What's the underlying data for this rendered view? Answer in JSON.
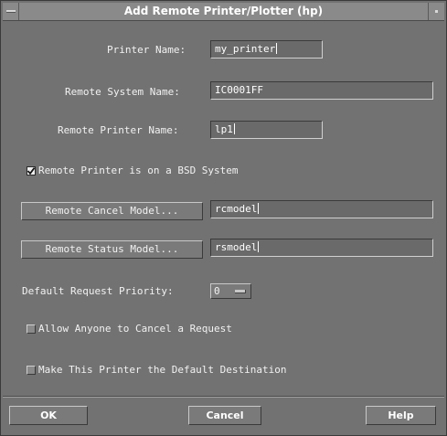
{
  "window": {
    "title": "Add Remote Printer/Plotter (hp)"
  },
  "form": {
    "printer_name_label": "Printer Name:",
    "printer_name_value": "my_printer",
    "remote_system_label": "Remote System Name:",
    "remote_system_value": "IC0001FF",
    "remote_printer_label": "Remote Printer Name:",
    "remote_printer_value": "lp1",
    "bsd_checkbox_label": "Remote Printer is on a BSD System",
    "bsd_checked": true,
    "cancel_model_button": "Remote Cancel Model...",
    "cancel_model_value": "rcmodel",
    "status_model_button": "Remote Status Model...",
    "status_model_value": "rsmodel",
    "priority_label": "Default Request Priority:",
    "priority_value": "0",
    "allow_cancel_label": "Allow Anyone to Cancel a Request",
    "allow_cancel_checked": false,
    "default_dest_label": "Make This Printer the Default Destination",
    "default_dest_checked": false
  },
  "footer": {
    "ok": "OK",
    "cancel": "Cancel",
    "help": "Help"
  },
  "colors": {
    "background": "#727272",
    "text": "#f2f2f2",
    "field": "#6a6a6a"
  }
}
